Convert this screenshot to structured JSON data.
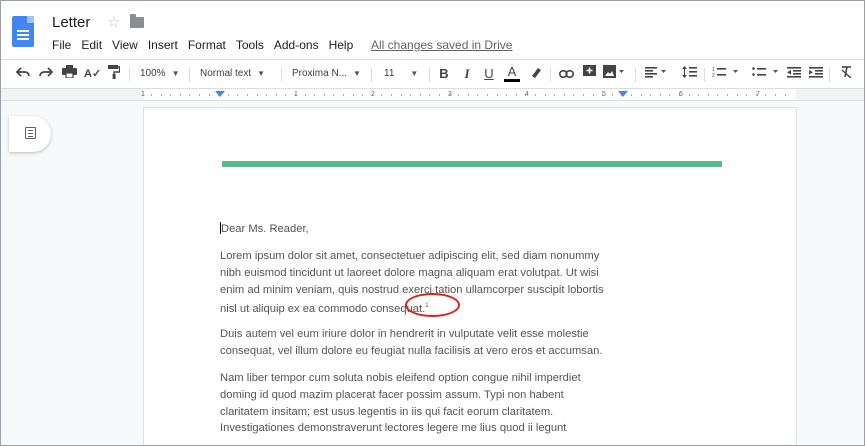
{
  "title": {
    "doc_name": "Letter",
    "star": "☆",
    "saved_status": "All changes saved in Drive"
  },
  "menu": [
    "File",
    "Edit",
    "View",
    "Insert",
    "Format",
    "Tools",
    "Add-ons",
    "Help"
  ],
  "toolbar": {
    "zoom": "100%",
    "style": "Normal text",
    "font": "Proxima N...",
    "size": "11",
    "bold": "B",
    "italic": "I",
    "underline": "U",
    "text_color": "A"
  },
  "ruler": {
    "numbers": [
      "1",
      "1",
      "2",
      "3",
      "4",
      "5",
      "6",
      "7"
    ]
  },
  "document": {
    "salutation": "Dear Ms. Reader,",
    "p1": [
      "Lorem ipsum dolor sit amet, consectetuer adipiscing elit, sed diam nonummy",
      "nibh euismod tincidunt ut laoreet dolore magna aliquam erat volutpat. Ut wisi",
      "enim ad minim veniam, quis nostrud exerci tation ullamcorper suscipit lobortis",
      "nisl ut aliquip ex ea commodo consequat."
    ],
    "footnote_ref": "1",
    "p2": [
      "Duis autem vel eum iriure dolor in hendrerit in vulputate velit esse molestie",
      "consequat, vel illum dolore eu feugiat nulla facilisis at vero eros et accumsan."
    ],
    "p3": [
      "Nam liber tempor cum soluta nobis eleifend option congue nihil imperdiet",
      "doming id quod mazim placerat facer possim assum. Typi non habent",
      "claritatem insitam; est usus legentis in iis qui facit eorum claritatem.",
      "Investigationes demonstraverunt lectores legere me lius quod ii legunt"
    ]
  },
  "colors": {
    "accent_green": "#57bb8a",
    "docs_blue": "#4285f4",
    "annotation_red": "#e02020"
  }
}
